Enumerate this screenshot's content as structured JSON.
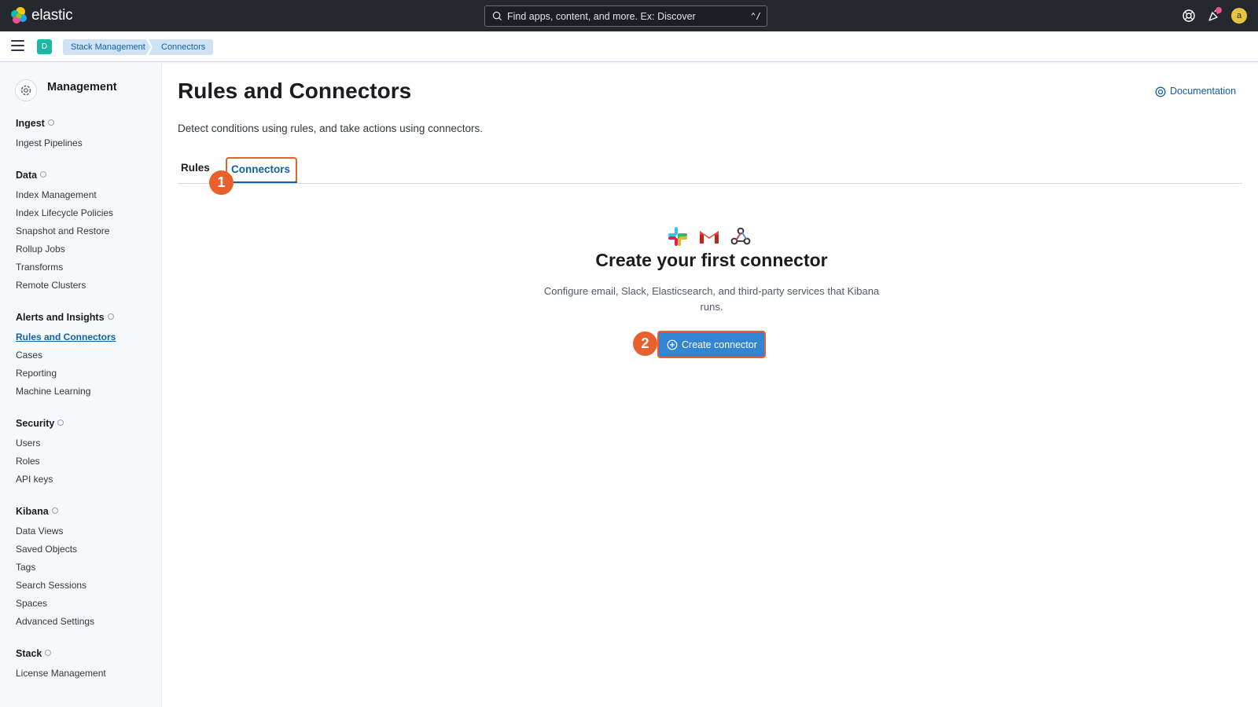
{
  "header": {
    "brand": "elastic",
    "search_placeholder": "Find apps, content, and more. Ex: Discover",
    "search_shortcut": "⌃/",
    "avatar_initial": "a",
    "icons": [
      "help-icon",
      "newsfeed-icon"
    ]
  },
  "subheader": {
    "space_initial": "D",
    "breadcrumbs": [
      "Stack Management",
      "Connectors"
    ]
  },
  "sidebar": {
    "title": "Management",
    "groups": [
      {
        "label": "Ingest",
        "items": [
          "Ingest Pipelines"
        ]
      },
      {
        "label": "Data",
        "items": [
          "Index Management",
          "Index Lifecycle Policies",
          "Snapshot and Restore",
          "Rollup Jobs",
          "Transforms",
          "Remote Clusters"
        ]
      },
      {
        "label": "Alerts and Insights",
        "items": [
          "Rules and Connectors",
          "Cases",
          "Reporting",
          "Machine Learning"
        ]
      },
      {
        "label": "Security",
        "items": [
          "Users",
          "Roles",
          "API keys"
        ]
      },
      {
        "label": "Kibana",
        "items": [
          "Data Views",
          "Saved Objects",
          "Tags",
          "Search Sessions",
          "Spaces",
          "Advanced Settings"
        ]
      },
      {
        "label": "Stack",
        "items": [
          "License Management"
        ]
      }
    ],
    "active_item": "Rules and Connectors"
  },
  "main": {
    "title": "Rules and Connectors",
    "documentation": "Documentation",
    "description": "Detect conditions using rules, and take actions using connectors.",
    "tabs": [
      "Rules",
      "Connectors"
    ],
    "selected_tab": "Connectors",
    "empty_state": {
      "icons": [
        "slack-icon",
        "gmail-icon",
        "webhook-icon"
      ],
      "title": "Create your first connector",
      "body": "Configure email, Slack, Elasticsearch, and third-party services that Kibana runs.",
      "button": "Create connector"
    },
    "step_markers": [
      "1",
      "2"
    ]
  },
  "colors": {
    "header_bg": "#25282f",
    "link": "#0f62a8",
    "primary_button": "#3385d3",
    "highlight": "#e8602c",
    "sidebar_bg": "#f7f8fc"
  }
}
